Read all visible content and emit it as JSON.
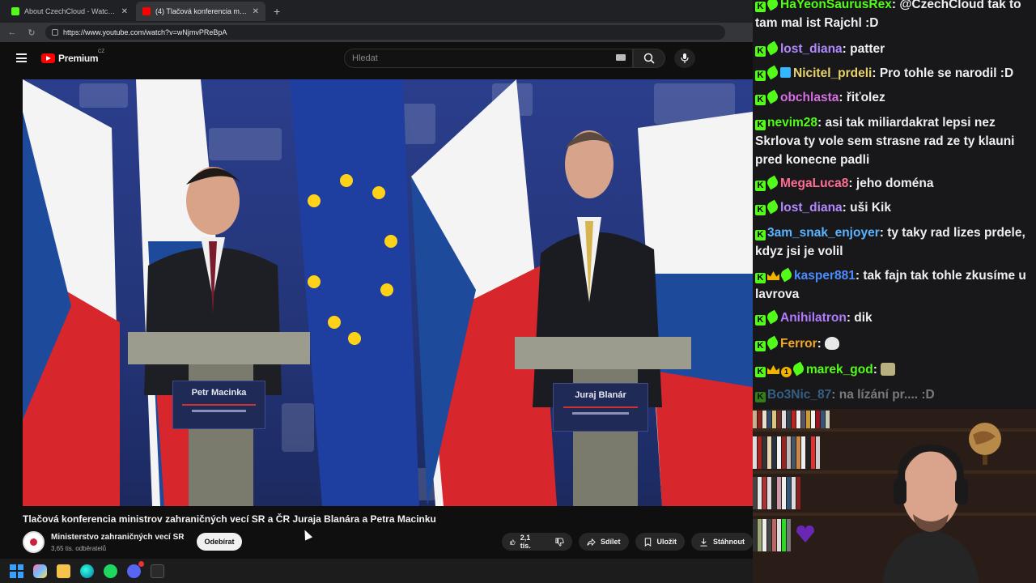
{
  "browser": {
    "tabs": [
      {
        "title": "About CzechCloud - Watch Live on",
        "favicon": "kick-icon",
        "active": false
      },
      {
        "title": "(4) Tlačová konferencia minist",
        "favicon": "youtube-icon",
        "active": true
      }
    ],
    "url": "https://www.youtube.com/watch?v=wNjmvPReBpA"
  },
  "youtube": {
    "brand": "Premium",
    "region": "CZ",
    "search_placeholder": "Hledat",
    "video": {
      "nameplate_left": "Petr Macinka",
      "nameplate_right": "Juraj Blanár",
      "title": "Tlačová konferencia ministrov zahraničných vecí SR a ČR Juraja Blanára a Petra Macinku"
    },
    "channel": {
      "name": "Ministerstvo zahraničných vecí SR",
      "subscribers": "3,65 tis. odběratelů",
      "subscribe_label": "Odebírat"
    },
    "actions": {
      "likes": "2,1 tis.",
      "share": "Sdílet",
      "save": "Uložit",
      "download": "Stáhnout"
    }
  },
  "chat": {
    "messages": [
      {
        "user": "HaYeonSaurusRex",
        "color": "#53fc18",
        "text": "@CzechCloud tak to tam mal ist Rajchl :D"
      },
      {
        "user": "lost_diana",
        "color": "#b389ff",
        "text": "patter"
      },
      {
        "user": "Nicitel_prdeli",
        "color": "#e8d36a",
        "text": "Pro tohle se narodil :D"
      },
      {
        "user": "obchlasta",
        "color": "#d56ee0",
        "text": "řiťolez"
      },
      {
        "user": "nevim28",
        "color": "#53fc18",
        "text": "asi tak miliardakrat lepsi nez Skrlova ty vole sem strasne rad ze ty klauni pred konecne padli"
      },
      {
        "user": "MegaLuca8",
        "color": "#ff6d93",
        "text": "jeho doména"
      },
      {
        "user": "lost_diana",
        "color": "#b389ff",
        "text": "uši Kik"
      },
      {
        "user": "3am_snak_enjoyer",
        "color": "#5ab4ff",
        "text": "ty taky rad lizes prdele, kdyz jsi je volil"
      },
      {
        "user": "kasper881",
        "color": "#4b8dff",
        "text": "tak fajn tak tohle zkusíme u lavrova"
      },
      {
        "user": "Anihilatron",
        "color": "#b07bff",
        "text": "dik"
      },
      {
        "user": "Ferror",
        "color": "#f5a623",
        "text": ""
      },
      {
        "user": "marek_god",
        "color": "#53fc18",
        "text": ""
      },
      {
        "user": "Bo3Nic_87",
        "color": "#5ab4ff",
        "text": "na lízání pr.... :D"
      }
    ]
  },
  "taskbar": {
    "apps": [
      "windows-start-icon",
      "copilot-icon",
      "file-explorer-icon",
      "edge-icon",
      "spotify-icon",
      "discord-icon",
      "epic-games-icon"
    ]
  }
}
